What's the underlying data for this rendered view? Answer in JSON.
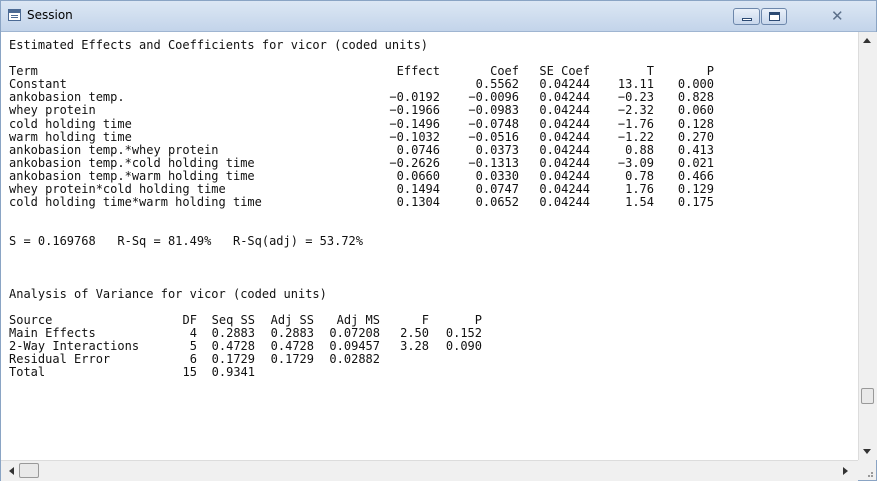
{
  "window": {
    "title": "Session"
  },
  "section1": {
    "heading": "Estimated Effects and Coefficients for vicor (coded units)",
    "columns": [
      "Term",
      "Effect",
      "Coef",
      "SE Coef",
      "T",
      "P"
    ],
    "rows": [
      [
        "Constant",
        "",
        "0.5562",
        "0.04244",
        "13.11",
        "0.000"
      ],
      [
        "ankobasion temp.",
        "−0.0192",
        "−0.0096",
        "0.04244",
        "−0.23",
        "0.828"
      ],
      [
        "whey protein",
        "−0.1966",
        "−0.0983",
        "0.04244",
        "−2.32",
        "0.060"
      ],
      [
        "cold holding time",
        "−0.1496",
        "−0.0748",
        "0.04244",
        "−1.76",
        "0.128"
      ],
      [
        "warm holding time",
        "−0.1032",
        "−0.0516",
        "0.04244",
        "−1.22",
        "0.270"
      ],
      [
        "ankobasion temp.*whey protein",
        "0.0746",
        "0.0373",
        "0.04244",
        "0.88",
        "0.413"
      ],
      [
        "ankobasion temp.*cold holding time",
        "−0.2626",
        "−0.1313",
        "0.04244",
        "−3.09",
        "0.021"
      ],
      [
        "ankobasion temp.*warm holding time",
        "0.0660",
        "0.0330",
        "0.04244",
        "0.78",
        "0.466"
      ],
      [
        "whey protein*cold holding time",
        "0.1494",
        "0.0747",
        "0.04244",
        "1.76",
        "0.129"
      ],
      [
        "cold holding time*warm holding time",
        "0.1304",
        "0.0652",
        "0.04244",
        "1.54",
        "0.175"
      ]
    ]
  },
  "summary": "S = 0.169768   R-Sq = 81.49%   R-Sq(adj) = 53.72%",
  "section2": {
    "heading": "Analysis of Variance for vicor (coded units)",
    "columns": [
      "Source",
      "DF",
      "Seq SS",
      "Adj SS",
      "Adj MS",
      "F",
      "P"
    ],
    "rows": [
      [
        "Main Effects",
        "4",
        "0.2883",
        "0.2883",
        "0.07208",
        "2.50",
        "0.152"
      ],
      [
        "2-Way Interactions",
        "5",
        "0.4728",
        "0.4728",
        "0.09457",
        "3.28",
        "0.090"
      ],
      [
        "Residual Error",
        "6",
        "0.1729",
        "0.1729",
        "0.02882",
        "",
        ""
      ],
      [
        "Total",
        "15",
        "0.9341",
        "",
        "",
        "",
        ""
      ]
    ]
  },
  "icons": {
    "app": "session-window-icon",
    "minimize": "minimize-icon",
    "maximize": "maximize-icon",
    "close": "close-icon"
  }
}
